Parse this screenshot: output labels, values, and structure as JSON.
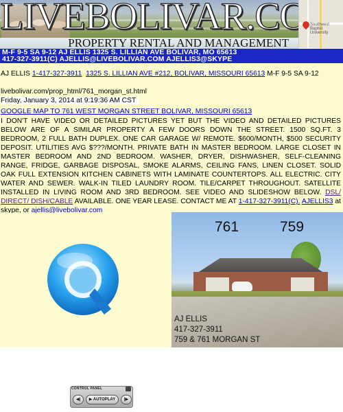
{
  "banner": {
    "site_title": "LIVEBOLIVAR.COM",
    "subtitle": "PROPERTY RENTAL AND MANAGEMENT",
    "info_line1": "M-F 9-5  SA 9-12   AJ ELLIS  1325 S. LILLIAN AVE BOLIVAR, MO 65613",
    "info_line2": "417-327-3911(C)   AJELLIS@LIVEBOLIVAR.COM   AJELLIS3@SKYPE",
    "map_label": "Southwest\nBaptist\nUniversity"
  },
  "contact_line": {
    "name": "AJ ELLIS",
    "phone": "1-417-327-3911",
    "address": "1325 S. LILLIAN AVE #212, BOLIVAR, MISSOURI 65613",
    "hours": "M-F 9-5 SA 9-12"
  },
  "page_url": "livebolivar.com/prop_html/761_morgan_st.html",
  "date": "Friday, January 3, 2014 at 9:19:36 AM CST",
  "map_link": "GOOGLE MAP TO 761 WEST MORGAN STREET BOLIVAR, MISSOURI 65613",
  "description": {
    "text": "I DON'T HAVE VIDEO OR DETAILED PICTURES YET BUT THE VIDEO AND DETAILED PICTURES BELOW ARE OF A SIMILAR PROPERTY A FEW DOORS DOWN THE STREET.  1500 SQ.FT. 3 BEDROOM, 2 FULL BATH DUPLEX.  ONE CAR GARAGE W/ REMOTE.  $600/MONTH, $500 SECURITY DEPOSIT.  UTILITIES AVG $???/MONTH.  PRIVATE BATH IN MASTER BEDROOM.  LARGE CLOSET IN MASTER BEDROOM AND 2ND BEDROOM.  WASHER, DRYER, DISHWASHER, SELF-CLEANING RANGE, FRIDGE, GARBAGE DISPOSAL, SMOKE ALARMS, CEILING FANS,  LINEN CLOSET.  SOLID OAK FULL EXTENSION KITCHEN CABINETS WITH LAMINATE COUNTERTOPS.   ALL ELECTRIC.  CITY WATER AND SEWER.  WALK-IN TILED LAUNDRY ROOM.  TILE/CARPET THROUGHOUT.  SATELLITE INSTALLED IN LIVING ROOM AND 3RD BEDROOM.  SEE VIDEO AND SLIDESHOW BELOW. ",
    "dsl_link": "DSL/ DIRECT/ DISH/CABLE",
    "after_dsl": " AVAILABLE.  ONE YEAR LEASE.  CONTACT ME AT ",
    "phone_link": "1-417-327-3911(C).",
    "mid": "  ",
    "skype_link": "AJELLIS3",
    "skype_text": " at skype, or ",
    "email_link": "ajellis@livebolivar.com"
  },
  "photo": {
    "number_left": "761",
    "number_right": "759",
    "caption_name": "AJ ELLIS",
    "caption_phone": "417-327-3911",
    "caption_address": "759 & 761 MORGAN ST"
  },
  "control_panel": {
    "title": "CONTROL PANEL",
    "autoplay_label": "AUTOPLAY"
  }
}
